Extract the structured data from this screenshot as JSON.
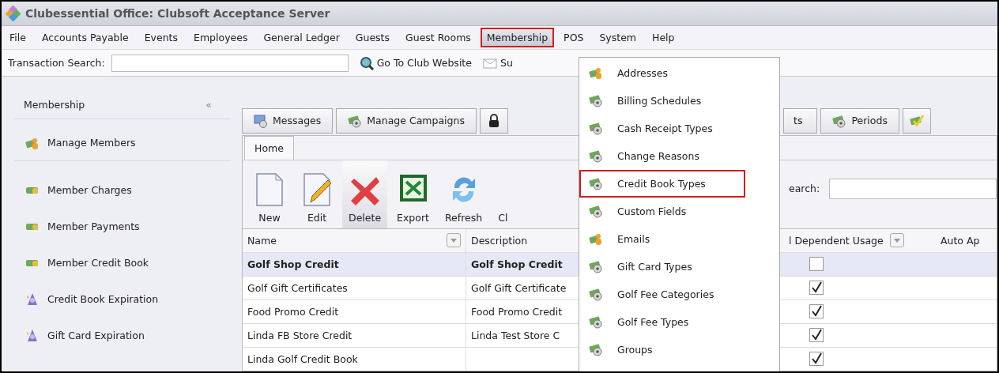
{
  "window": {
    "title": "Clubessential Office: Clubsoft Acceptance Server"
  },
  "menu": [
    {
      "label": "File",
      "selected": false,
      "annotated": false
    },
    {
      "label": "Accounts Payable",
      "selected": false,
      "annotated": false
    },
    {
      "label": "Events",
      "selected": false,
      "annotated": false
    },
    {
      "label": "Employees",
      "selected": false,
      "annotated": false
    },
    {
      "label": "General Ledger",
      "selected": false,
      "annotated": false
    },
    {
      "label": "Guests",
      "selected": false,
      "annotated": false
    },
    {
      "label": "Guest Rooms",
      "selected": false,
      "annotated": false
    },
    {
      "label": "Membership",
      "selected": true,
      "annotated": true
    },
    {
      "label": "POS",
      "selected": false,
      "annotated": false
    },
    {
      "label": "System",
      "selected": false,
      "annotated": false
    },
    {
      "label": "Help",
      "selected": false,
      "annotated": false
    }
  ],
  "toolbar": {
    "search_label": "Transaction Search:",
    "links": [
      {
        "label": "Go To Club Website"
      },
      {
        "label": "Su"
      }
    ]
  },
  "sidebar": {
    "title": "Membership",
    "collapse": "«",
    "items": [
      {
        "label": "Manage Members"
      },
      {
        "label": "Member Charges"
      },
      {
        "label": "Member Payments"
      },
      {
        "label": "Member Credit Book"
      },
      {
        "label": "Credit Book Expiration"
      },
      {
        "label": "Gift Card Expiration"
      }
    ]
  },
  "tabs": [
    {
      "kind": "text",
      "label": "Messages"
    },
    {
      "kind": "text",
      "label": "Manage Campaigns"
    },
    {
      "kind": "icon"
    },
    {
      "kind": "text",
      "label": "ts"
    },
    {
      "kind": "text",
      "label": "Periods"
    },
    {
      "kind": "icon"
    }
  ],
  "ribbon": {
    "tab": "Home",
    "buttons": [
      {
        "label": "New",
        "hovered": false
      },
      {
        "label": "Edit",
        "hovered": false
      },
      {
        "label": "Delete",
        "hovered": true
      },
      {
        "label": "Export",
        "hovered": false
      },
      {
        "label": "Refresh",
        "hovered": false
      },
      {
        "label": "Cl",
        "hovered": false
      }
    ],
    "search_label": "earch:"
  },
  "grid": {
    "columns": [
      {
        "label": "Name",
        "filter": true
      },
      {
        "label": "Description",
        "filter": false
      },
      {
        "label": "l Dependent Usage",
        "filter": true
      },
      {
        "label": "Auto Ap",
        "filter": false
      }
    ],
    "rows": [
      {
        "name": "Golf Shop Credit",
        "description": "Golf Shop Credit",
        "dependent_usage": false,
        "selected": true
      },
      {
        "name": "Golf Gift Certificates",
        "description": "Golf Gift Certificate",
        "dependent_usage": true,
        "selected": false
      },
      {
        "name": "Food Promo Credit",
        "description": "Food Promo Credit",
        "dependent_usage": true,
        "selected": false
      },
      {
        "name": "Linda FB Store Credit",
        "description": "Linda Test Store C",
        "dependent_usage": true,
        "selected": false
      },
      {
        "name": "Linda Golf Credit Book",
        "dependent_usage": true,
        "selected": false
      }
    ]
  },
  "dropdown": {
    "items": [
      {
        "label": "Addresses",
        "annotated": false
      },
      {
        "label": "Billing Schedules",
        "annotated": false
      },
      {
        "label": "Cash Receipt Types",
        "annotated": false
      },
      {
        "label": "Change Reasons",
        "annotated": false
      },
      {
        "label": "Credit Book Types",
        "annotated": true
      },
      {
        "label": "Custom Fields",
        "annotated": false
      },
      {
        "label": "Emails",
        "annotated": false
      },
      {
        "label": "Gift Card Types",
        "annotated": false
      },
      {
        "label": "Golf Fee Categories",
        "annotated": false
      },
      {
        "label": "Golf Fee Types",
        "annotated": false
      },
      {
        "label": "Groups",
        "annotated": false
      }
    ]
  }
}
